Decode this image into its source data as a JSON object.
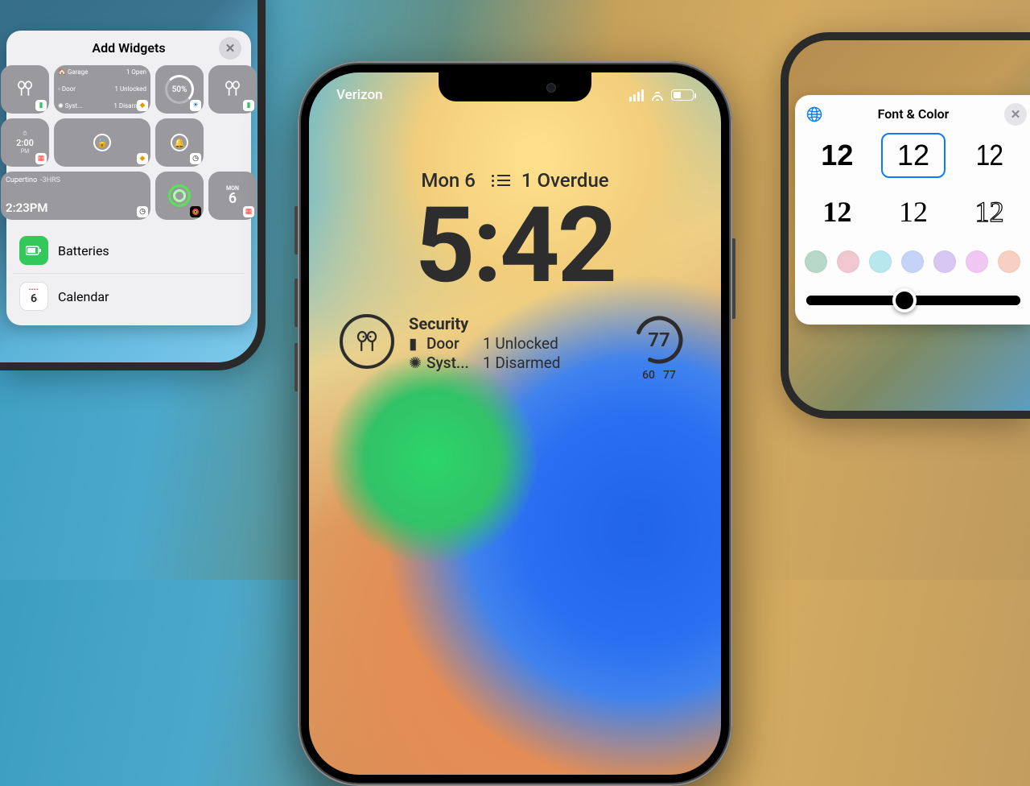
{
  "left": {
    "title": "Add Widgets",
    "grid": {
      "secTitle": "Garage",
      "sec1a": "Door",
      "sec1b": "1 Open",
      "sec2a": "Door",
      "sec2b": "1 Unlocked",
      "sec3a": "Syst...",
      "sec3b": "1 Disarmed",
      "pct": "50%",
      "clockLabel": "PM",
      "clockTime": "2:00",
      "cupertino": "Cupertino",
      "cupOffset": "-3HRS",
      "cupTime": "2:23PM",
      "calDay": "MON",
      "calNum": "6"
    },
    "rows": {
      "batteries": "Batteries",
      "calendar": "Calendar"
    }
  },
  "center": {
    "carrier": "Verizon",
    "date": "Mon 6",
    "overdue": "1 Overdue",
    "time": "5:42",
    "security": {
      "title": "Security",
      "r1a": "Door",
      "r1b": "1 Unlocked",
      "r2a": "Syst...",
      "r2b": "1 Disarmed"
    },
    "weather": {
      "temp": "77",
      "lo": "60",
      "hi": "77"
    }
  },
  "right": {
    "title": "Font & Color",
    "sample": "12",
    "selectedIndex": 1,
    "colors": [
      "#b7d8c9",
      "#f1c7d2",
      "#b6e8ee",
      "#c5d3f6",
      "#d8c7f3",
      "#f0c7f3",
      "#f7d0c3"
    ]
  }
}
